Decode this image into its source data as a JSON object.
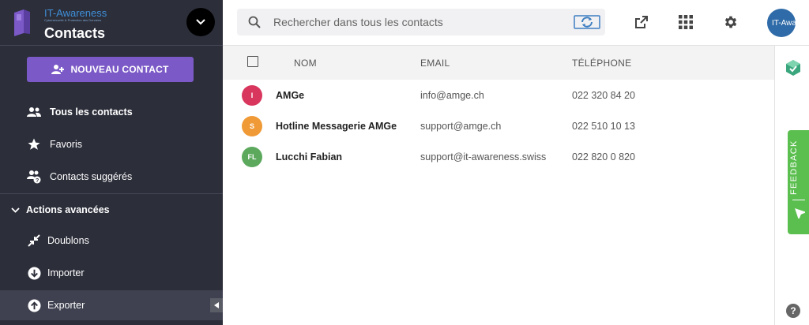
{
  "brand": {
    "name": "IT-Awareness",
    "tagline": "Cybersécurité & Protection des Données",
    "app_title": "Contacts"
  },
  "sidebar": {
    "new_contact_label": "NOUVEAU CONTACT",
    "items": [
      {
        "label": "Tous les contacts",
        "icon": "people-icon"
      },
      {
        "label": "Favoris",
        "icon": "star-icon"
      },
      {
        "label": "Contacts suggérés",
        "icon": "suggested-contacts-icon"
      }
    ],
    "advanced_section_label": "Actions avancées",
    "advanced_items": [
      {
        "label": "Doublons",
        "icon": "merge-icon"
      },
      {
        "label": "Importer",
        "icon": "import-icon"
      },
      {
        "label": "Exporter",
        "icon": "export-icon"
      }
    ]
  },
  "search": {
    "placeholder": "Rechercher dans tous les contacts"
  },
  "user": {
    "avatar_text": "IT-Aware"
  },
  "table": {
    "headers": {
      "name": "NOM",
      "email": "EMAIL",
      "phone": "TÉLÉPHONE"
    },
    "rows": [
      {
        "initials": "I",
        "name": "AMGe",
        "email": "info@amge.ch",
        "phone": "022 320 84 20",
        "color": "#d9365e"
      },
      {
        "initials": "S",
        "name": "Hotline Messagerie AMGe",
        "email": "support@amge.ch",
        "phone": "022 510 10 13",
        "color": "#ef9a36"
      },
      {
        "initials": "FL",
        "name": "Lucchi Fabian",
        "email": "support@it-awareness.swiss",
        "phone": "022 820 0 820",
        "color": "#5ca95e"
      }
    ]
  },
  "feedback": {
    "label": "FEEDBACK"
  },
  "help": {
    "label": "?"
  },
  "colors": {
    "sidebar_bg": "#2c2e3a",
    "accent": "#7b59c7",
    "feedback": "#5bbf4f"
  }
}
